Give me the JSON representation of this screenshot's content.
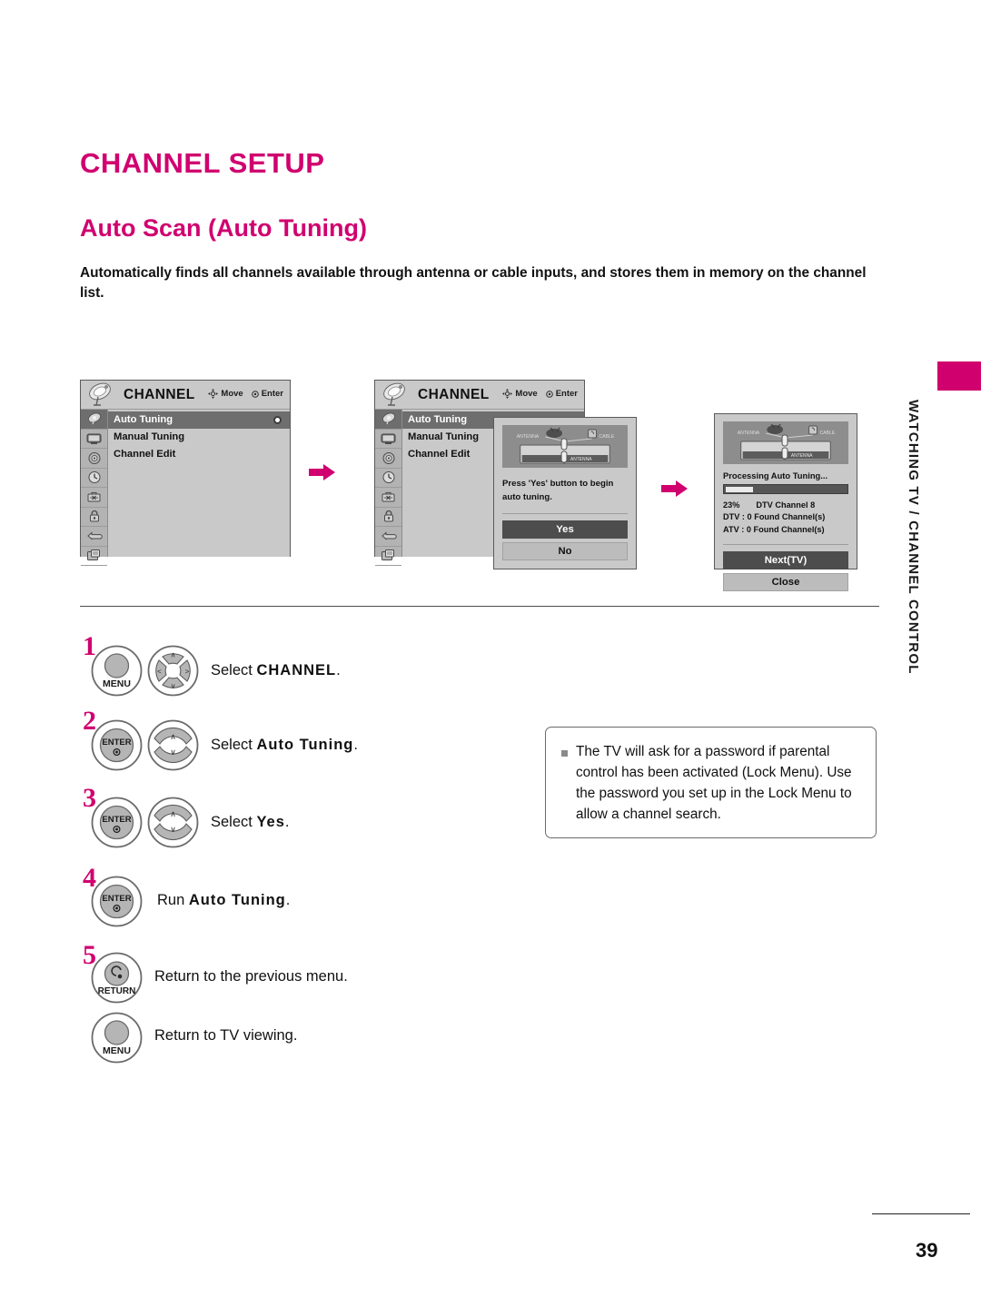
{
  "page": {
    "title": "CHANNEL SETUP",
    "section_title": "Auto Scan (Auto Tuning)",
    "intro": "Automatically finds all channels available through antenna or cable inputs, and stores them in memory on the channel list.",
    "side_tab": "WATCHING TV / CHANNEL CONTROL",
    "page_number": "39",
    "accent_color": "#d0006f"
  },
  "osd": {
    "title": "CHANNEL",
    "hint_move": "Move",
    "hint_enter": "Enter",
    "menu_items": [
      {
        "label": "Auto Tuning",
        "selected": true,
        "radio": true
      },
      {
        "label": "Manual Tuning",
        "selected": false,
        "radio": false
      },
      {
        "label": "Channel Edit",
        "selected": false,
        "radio": false
      }
    ],
    "rail_icons": [
      "satellite-dish-icon",
      "picture-tv-icon",
      "audio-speaker-icon",
      "time-clock-icon",
      "setup-toolbox-icon",
      "lock-padlock-icon",
      "input-plug-icon",
      "usb-card-icon"
    ]
  },
  "dialog_confirm": {
    "illustration": "antenna-cable-diagram",
    "illustration_labels": {
      "antenna": "ANTENNA",
      "cable": "CABLE",
      "port": "ANTENNA"
    },
    "message": "Press 'Yes' button to begin auto tuning.",
    "buttons": [
      {
        "label": "Yes",
        "style": "primary"
      },
      {
        "label": "No",
        "style": "secondary"
      }
    ]
  },
  "dialog_progress": {
    "illustration": "antenna-cable-diagram",
    "illustration_labels": {
      "antenna": "ANTENNA",
      "cable": "CABLE",
      "port": "ANTENNA"
    },
    "status": "Processing Auto Tuning...",
    "percent": "23%",
    "percent_value": 23,
    "current_channel": "DTV Channel 8",
    "dtv_found": "DTV : 0 Found Channel(s)",
    "atv_found": "ATV : 0 Found Channel(s)",
    "buttons": [
      {
        "label": "Next(TV)",
        "style": "primary"
      },
      {
        "label": "Close",
        "style": "secondary"
      }
    ]
  },
  "steps": [
    {
      "number": "1",
      "buttons": [
        "MENU",
        "nav-wheel"
      ],
      "text_prefix": "Select ",
      "text_emphasis": "CHANNEL",
      "text_suffix": "."
    },
    {
      "number": "2",
      "buttons": [
        "ENTER",
        "updown-wheel"
      ],
      "text_prefix": "Select ",
      "text_emphasis": "Auto Tuning",
      "text_suffix": "."
    },
    {
      "number": "3",
      "buttons": [
        "ENTER",
        "updown-wheel"
      ],
      "text_prefix": "Select ",
      "text_emphasis": "Yes",
      "text_suffix": "."
    },
    {
      "number": "4",
      "buttons": [
        "ENTER"
      ],
      "text_prefix": "Run ",
      "text_emphasis": "Auto Tuning",
      "text_suffix": "."
    },
    {
      "number": "5",
      "buttons": [
        "RETURN"
      ],
      "text_prefix": "Return to the previous menu.",
      "text_emphasis": "",
      "text_suffix": ""
    },
    {
      "number": "",
      "buttons": [
        "MENU"
      ],
      "text_prefix": "Return to TV viewing.",
      "text_emphasis": "",
      "text_suffix": ""
    }
  ],
  "button_labels": {
    "menu": "MENU",
    "enter": "ENTER",
    "return": "RETURN"
  },
  "note": {
    "text": "The TV will ask for a password if parental control has been activated (Lock Menu). Use the password you set up in the Lock Menu to allow a channel search."
  }
}
